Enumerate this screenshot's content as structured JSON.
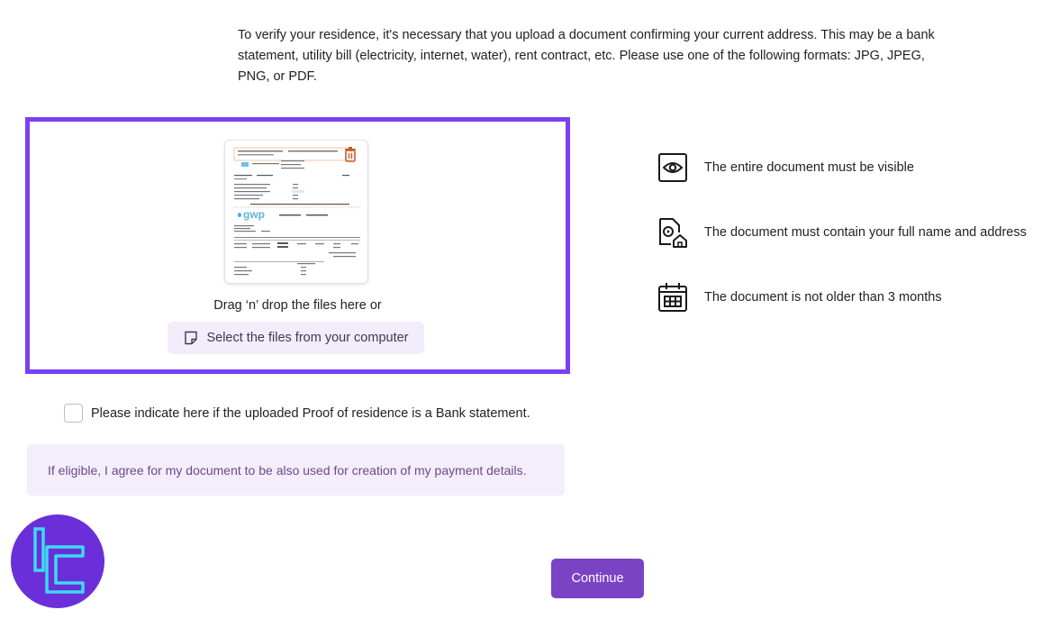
{
  "intro": {
    "text": "To verify your residence, it's necessary that you upload a document confirming your current address. This may be a bank statement, utility bill (electricity, internet, water), rent contract, etc. Please use one of the following formats: JPG, JPEG, PNG, or PDF."
  },
  "dropzone": {
    "drag_text": "Drag ‘n’ drop the files here or",
    "select_label": "Select the files from your computer",
    "preview_logo_text": "gwp",
    "accent_color": "#7b3ff2"
  },
  "requirements": [
    {
      "icon": "eye-icon",
      "text": "The entire document must be visible"
    },
    {
      "icon": "document-home-icon",
      "text": "The document must contain your full name and address"
    },
    {
      "icon": "calendar-icon",
      "text": "The document is not older than 3 months"
    }
  ],
  "bank_statement": {
    "label": "Please indicate here if the uploaded Proof of residence is a Bank statement.",
    "checked": false
  },
  "consent": {
    "text": "If eligible, I agree for my document to be also used for creation of my payment details."
  },
  "actions": {
    "continue_label": "Continue",
    "button_color": "#7a43c4"
  }
}
